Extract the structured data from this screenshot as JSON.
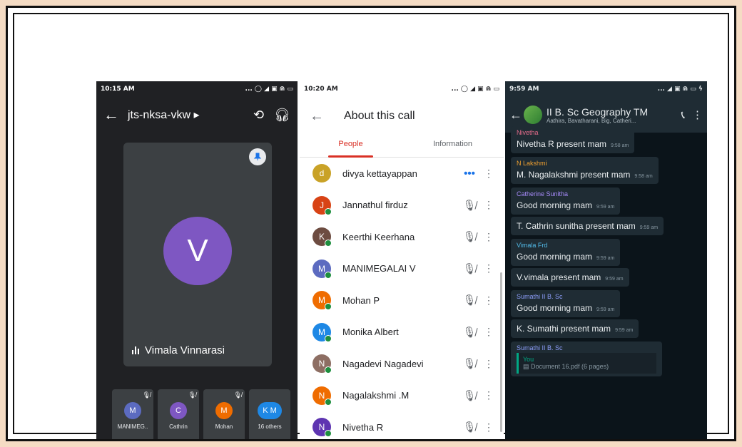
{
  "meet": {
    "status_time": "10:15 AM",
    "status_icons": "... ◯ ◢ ▣ ⋒ ▭",
    "meeting_code": "jts-nksa-vkw ▸",
    "main_initial": "V",
    "main_name": "Vimala Vinnarasi",
    "thumbs": [
      {
        "initial": "M",
        "label": "MANIMEG..",
        "color": "#5c6bc0"
      },
      {
        "initial": "C",
        "label": "Cathrin",
        "color": "#7e57c2"
      },
      {
        "initial": "M",
        "label": "Mohan",
        "color": "#ef6c00"
      },
      {
        "initial": "K  M",
        "label": "16 others",
        "color": "#1e88e5"
      }
    ]
  },
  "about": {
    "status_time": "10:20 AM",
    "status_icons": "... ◯ ◢ ▣ ⋒ ▭",
    "title": "About this call",
    "tab_people": "People",
    "tab_info": "Information",
    "people": [
      {
        "name": "divya kettayappan",
        "initial": "d",
        "color": "#c9a227",
        "speaking": true
      },
      {
        "name": "Jannathul firduz",
        "initial": "J",
        "color": "#d84315",
        "speaking": false
      },
      {
        "name": "Keerthi Keerhana",
        "initial": "K",
        "color": "#6d4c41",
        "speaking": false
      },
      {
        "name": "MANIMEGALAI V",
        "initial": "M",
        "color": "#5c6bc0",
        "speaking": false
      },
      {
        "name": "Mohan P",
        "initial": "M",
        "color": "#ef6c00",
        "speaking": false
      },
      {
        "name": "Monika Albert",
        "initial": "M",
        "color": "#1e88e5",
        "speaking": false
      },
      {
        "name": "Nagadevi Nagadevi",
        "initial": "N",
        "color": "#8d6e63",
        "speaking": false
      },
      {
        "name": "Nagalakshmi .M",
        "initial": "N",
        "color": "#ef6c00",
        "speaking": false
      },
      {
        "name": "Nivetha R",
        "initial": "N",
        "color": "#5e35b1",
        "speaking": false
      }
    ]
  },
  "wa": {
    "status_time": "9:59 AM",
    "status_icons": "... ◢ ▣ ⋒ ▭ ϟ",
    "group_name": "II B. Sc Geography TM",
    "members": "Aathira, Bavatharani, Big, Catheri...",
    "messages": [
      {
        "sender": "Nivetha",
        "color": "#e26b8a",
        "text": "Nivetha R present mam",
        "time": "9:58 am"
      },
      {
        "sender": "N Lakshmi",
        "color": "#f0a030",
        "text": "M. Nagalakshmi present mam",
        "time": "9:58 am"
      },
      {
        "sender": "Catherine Sunitha",
        "color": "#a78bfa",
        "text": "Good morning mam",
        "time": "9:59 am"
      },
      {
        "sender": "",
        "color": "",
        "text": "T. Cathrin sunitha present mam",
        "time": "9:59 am"
      },
      {
        "sender": "Vimala Frd",
        "color": "#53bdeb",
        "text": "Good morning mam",
        "time": "9:59 am"
      },
      {
        "sender": "",
        "color": "",
        "text": "V.vimala present mam",
        "time": "9:59 am"
      },
      {
        "sender": "Sumathi II B. Sc",
        "color": "#8b9cf7",
        "text": "Good morning mam",
        "time": "9:59 am"
      },
      {
        "sender": "",
        "color": "",
        "text": "K. Sumathi present mam",
        "time": "9:59 am"
      }
    ],
    "last_sender": "Sumathi II B. Sc",
    "quote_you": "You",
    "quote_doc": "Document 16.pdf (6 pages)"
  }
}
